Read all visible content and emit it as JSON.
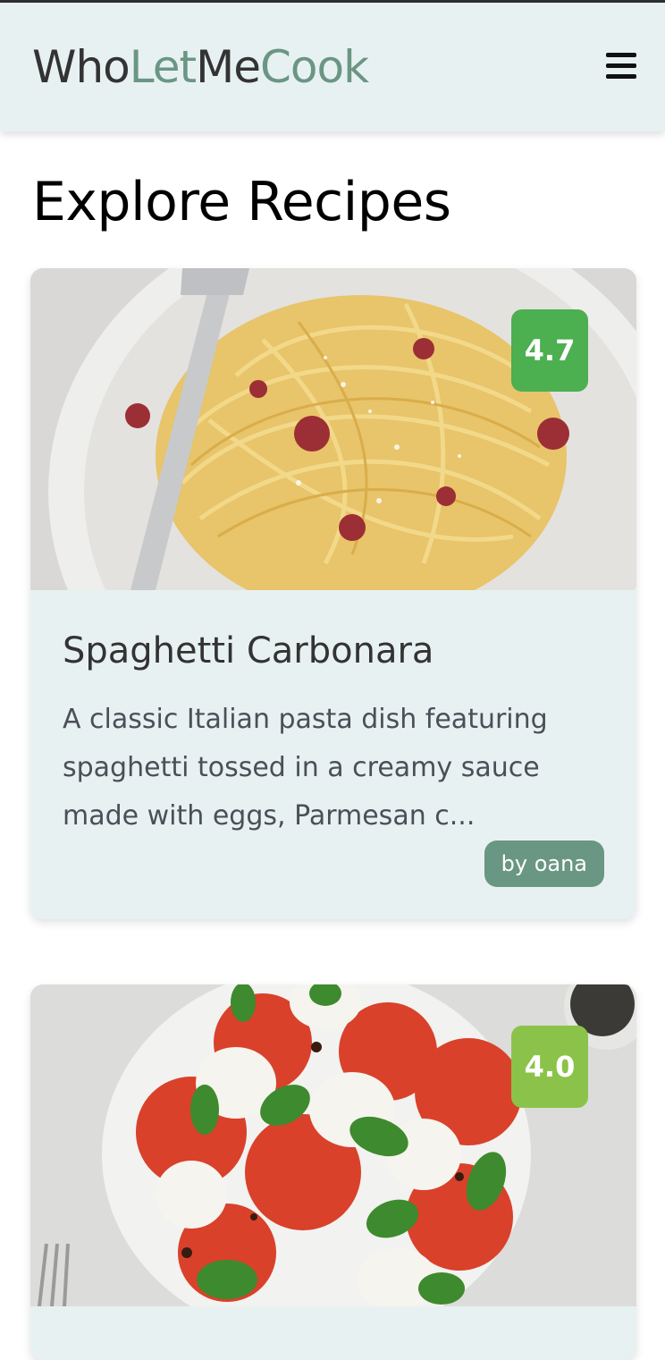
{
  "header": {
    "logo_parts": [
      "Who",
      "Let",
      "Me",
      "Cook"
    ],
    "menu_icon": "hamburger-menu-icon"
  },
  "main": {
    "title": "Explore Recipes",
    "recipes": [
      {
        "rating": "4.7",
        "rating_color": "#4caf50",
        "title": "Spaghetti Carbonara",
        "description": "A classic Italian pasta dish featuring spaghetti tossed in a creamy sauce made with eggs, Parmesan c...",
        "author": "by oana",
        "image": "spaghetti-carbonara-photo"
      },
      {
        "rating": "4.0",
        "rating_color": "#8bc34a",
        "image": "caprese-salad-photo"
      }
    ]
  },
  "colors": {
    "header_bg": "#e8f1f1",
    "brand_green": "#6a9684",
    "brand_dark": "#333333",
    "card_bg": "#e8f1f1"
  }
}
